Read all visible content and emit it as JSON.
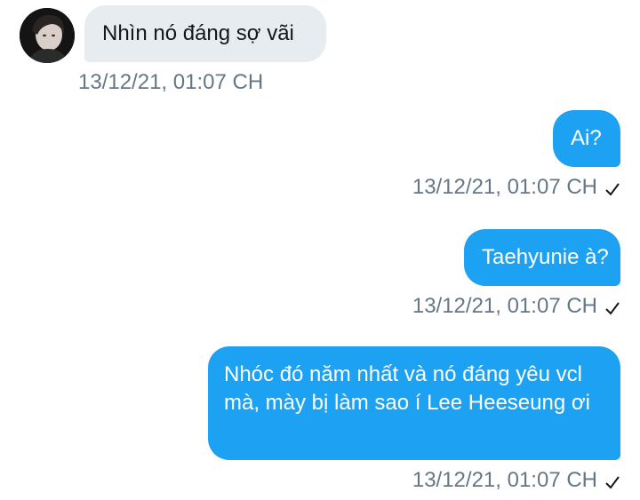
{
  "conversation": {
    "messages": [
      {
        "direction": "incoming",
        "text": "Nhìn nó đáng sợ vãi",
        "timestamp": "13/12/21, 01:07 CH",
        "read_receipt": false
      },
      {
        "direction": "outgoing",
        "text": "Ai?",
        "timestamp": "13/12/21, 01:07 CH",
        "read_receipt": true
      },
      {
        "direction": "outgoing",
        "text": "Taehyunie à?",
        "timestamp": "13/12/21, 01:07 CH",
        "read_receipt": true
      },
      {
        "direction": "outgoing",
        "text": "Nhóc đó năm nhất và nó đáng yêu vcl mà, mày bị làm sao í Lee Heeseung ơi",
        "timestamp": "13/12/21, 01:07 CH",
        "read_receipt": true
      }
    ],
    "icons": {
      "avatar": "contact-avatar",
      "check": "check-icon"
    },
    "colors": {
      "outgoing_bubble": "#1da1f2",
      "incoming_bubble": "#e6ecf0",
      "timestamp": "#657786"
    }
  }
}
